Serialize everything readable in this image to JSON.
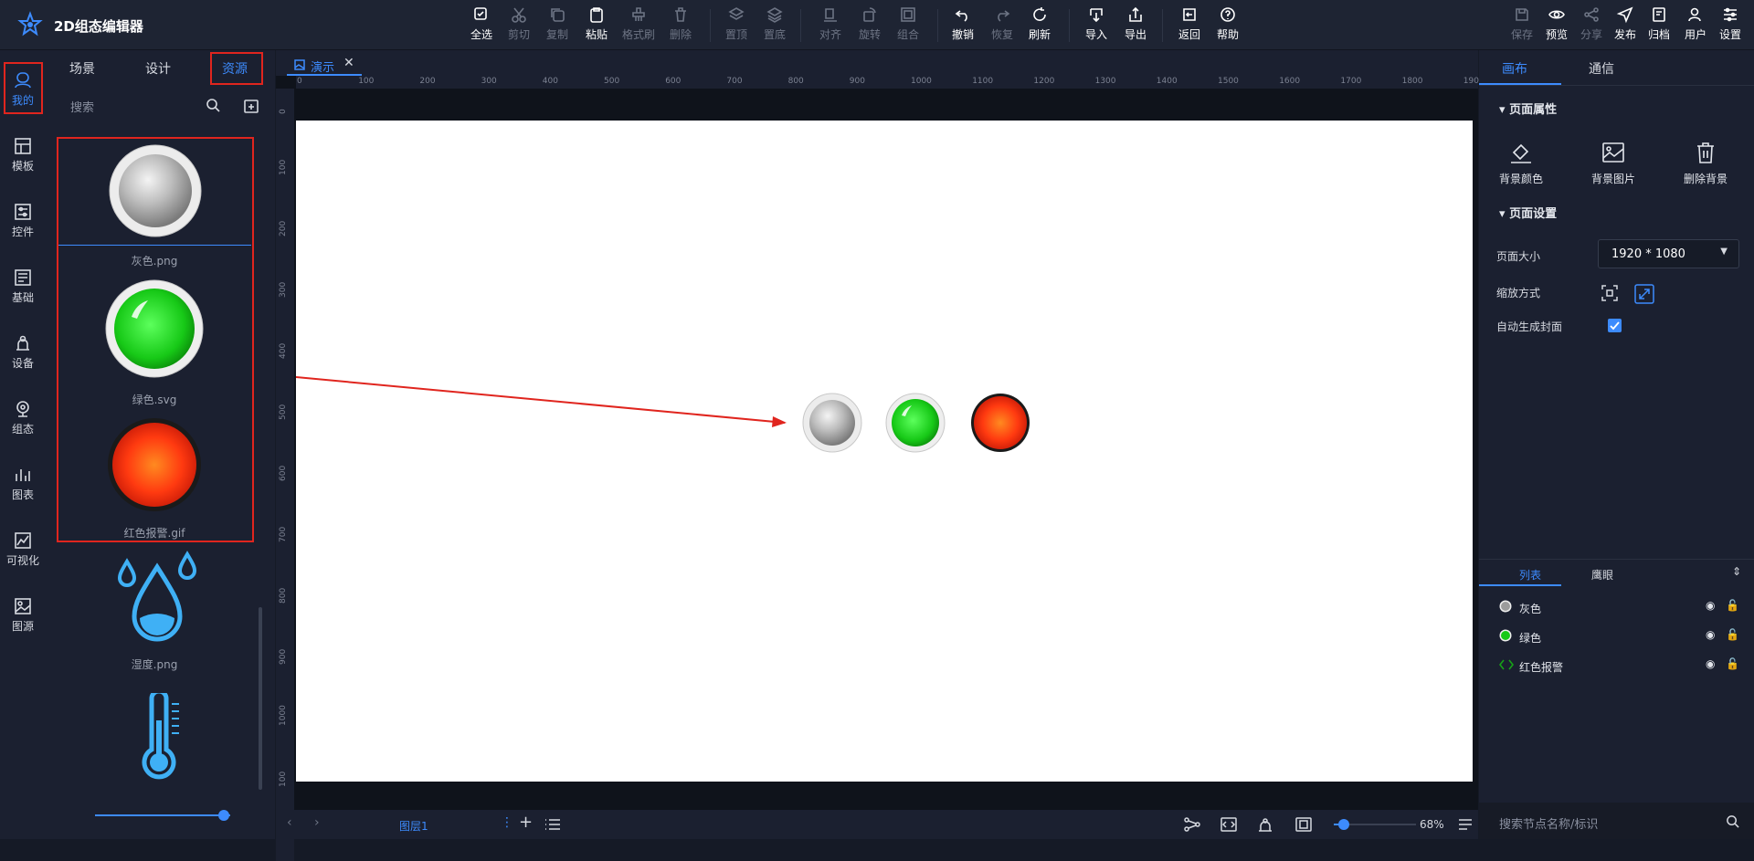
{
  "app": {
    "title": "2D组态编辑器"
  },
  "toolbar": {
    "select_all": "全选",
    "cut": "剪切",
    "copy": "复制",
    "paste": "粘贴",
    "format_brush": "格式刷",
    "delete": "删除",
    "bring_top": "置顶",
    "send_bottom": "置底",
    "align": "对齐",
    "rotate": "旋转",
    "group": "组合",
    "undo": "撤销",
    "redo": "恢复",
    "refresh": "刷新",
    "import": "导入",
    "export": "导出",
    "back": "返回",
    "help": "帮助",
    "save": "保存",
    "preview": "预览",
    "share": "分享",
    "publish": "发布",
    "archive": "归档",
    "user": "用户",
    "settings": "设置"
  },
  "left_nav": [
    {
      "label": "我的"
    },
    {
      "label": "模板"
    },
    {
      "label": "控件"
    },
    {
      "label": "基础"
    },
    {
      "label": "设备"
    },
    {
      "label": "组态"
    },
    {
      "label": "图表"
    },
    {
      "label": "可视化"
    },
    {
      "label": "图源"
    }
  ],
  "left_panel": {
    "tabs": [
      {
        "label": "场景"
      },
      {
        "label": "设计"
      },
      {
        "label": "资源"
      }
    ],
    "search_placeholder": "搜索",
    "resources": [
      {
        "name": "灰色.png"
      },
      {
        "name": "绿色.svg"
      },
      {
        "name": "红色报警.gif"
      },
      {
        "name": "湿度.png"
      }
    ]
  },
  "document_tab": {
    "label": "演示"
  },
  "ruler": {
    "h": [
      "0",
      "100",
      "200",
      "300",
      "400",
      "500",
      "600",
      "700",
      "800",
      "900",
      "1000",
      "1100",
      "1200",
      "1300",
      "1400",
      "1500",
      "1600",
      "1700",
      "1800",
      "1900"
    ],
    "v": [
      "0",
      "100",
      "200",
      "300",
      "400",
      "500",
      "600",
      "700",
      "800",
      "900",
      "1000",
      "100"
    ]
  },
  "bottom_bar": {
    "layer": "图层1",
    "zoom": "68%",
    "zoom_fraction": 0.12
  },
  "right_panel": {
    "tabs": [
      {
        "label": "画布"
      },
      {
        "label": "通信"
      }
    ],
    "page_props_title": "页面属性",
    "actions": [
      {
        "label": "背景颜色"
      },
      {
        "label": "背景图片"
      },
      {
        "label": "删除背景"
      }
    ],
    "page_settings_title": "页面设置",
    "page_size_label": "页面大小",
    "page_size_value": "1920 * 1080",
    "scale_mode_label": "缩放方式",
    "auto_cover_label": "自动生成封面",
    "auto_cover_checked": true,
    "layer_tabs": [
      {
        "label": "列表"
      },
      {
        "label": "鹰眼"
      }
    ],
    "layers": [
      {
        "name": "灰色"
      },
      {
        "name": "绿色"
      },
      {
        "name": "红色报警"
      }
    ],
    "node_search_placeholder": "搜索节点名称/标识"
  },
  "colors": {
    "accent": "#3d8bfd",
    "highlight": "#e0251e"
  }
}
